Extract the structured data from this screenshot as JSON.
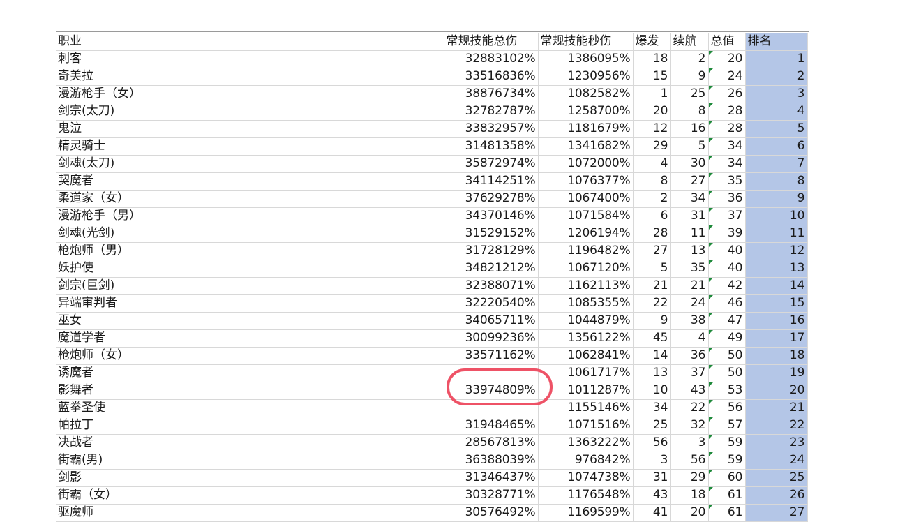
{
  "headers": {
    "job": "职业",
    "total_damage": "常规技能总伤",
    "dps": "常规技能秒伤",
    "burst": "爆发",
    "sustain": "续航",
    "total": "总值",
    "rank": "排名"
  },
  "rows": [
    {
      "job": "刺客",
      "total_damage": "32883102%",
      "dps": "1386095%",
      "burst": "18",
      "sustain": "2",
      "total": "20",
      "rank": "1"
    },
    {
      "job": "奇美拉",
      "total_damage": "33516836%",
      "dps": "1230956%",
      "burst": "15",
      "sustain": "9",
      "total": "24",
      "rank": "2"
    },
    {
      "job": "漫游枪手（女）",
      "total_damage": "38876734%",
      "dps": "1082582%",
      "burst": "1",
      "sustain": "25",
      "total": "26",
      "rank": "3"
    },
    {
      "job": "剑宗(太刀)",
      "total_damage": "32782787%",
      "dps": "1258700%",
      "burst": "20",
      "sustain": "8",
      "total": "28",
      "rank": "4"
    },
    {
      "job": "鬼泣",
      "total_damage": "33832957%",
      "dps": "1181679%",
      "burst": "12",
      "sustain": "16",
      "total": "28",
      "rank": "5"
    },
    {
      "job": "精灵骑士",
      "total_damage": "31481358%",
      "dps": "1341682%",
      "burst": "29",
      "sustain": "5",
      "total": "34",
      "rank": "6"
    },
    {
      "job": "剑魂(太刀)",
      "total_damage": "35872974%",
      "dps": "1072000%",
      "burst": "4",
      "sustain": "30",
      "total": "34",
      "rank": "7"
    },
    {
      "job": "契魔者",
      "total_damage": "34114251%",
      "dps": "1076377%",
      "burst": "8",
      "sustain": "27",
      "total": "35",
      "rank": "8"
    },
    {
      "job": "柔道家（女）",
      "total_damage": "37629278%",
      "dps": "1067400%",
      "burst": "2",
      "sustain": "34",
      "total": "36",
      "rank": "9"
    },
    {
      "job": "漫游枪手（男）",
      "total_damage": "34370146%",
      "dps": "1071584%",
      "burst": "6",
      "sustain": "31",
      "total": "37",
      "rank": "10"
    },
    {
      "job": "剑魂(光剑)",
      "total_damage": "31529152%",
      "dps": "1206194%",
      "burst": "28",
      "sustain": "11",
      "total": "39",
      "rank": "11"
    },
    {
      "job": "枪炮师（男）",
      "total_damage": "31728129%",
      "dps": "1196482%",
      "burst": "27",
      "sustain": "13",
      "total": "40",
      "rank": "12"
    },
    {
      "job": "妖护使",
      "total_damage": "34821212%",
      "dps": "1067120%",
      "burst": "5",
      "sustain": "35",
      "total": "40",
      "rank": "13"
    },
    {
      "job": "剑宗(巨剑)",
      "total_damage": "32388071%",
      "dps": "1162113%",
      "burst": "21",
      "sustain": "21",
      "total": "42",
      "rank": "14"
    },
    {
      "job": "异端审判者",
      "total_damage": "32220540%",
      "dps": "1085355%",
      "burst": "22",
      "sustain": "24",
      "total": "46",
      "rank": "15"
    },
    {
      "job": "巫女",
      "total_damage": "34065711%",
      "dps": "1044879%",
      "burst": "9",
      "sustain": "38",
      "total": "47",
      "rank": "16"
    },
    {
      "job": "魔道学者",
      "total_damage": "30099236%",
      "dps": "1356122%",
      "burst": "45",
      "sustain": "4",
      "total": "49",
      "rank": "17"
    },
    {
      "job": "枪炮师（女）",
      "total_damage": "33571162%",
      "dps": "1062841%",
      "burst": "14",
      "sustain": "36",
      "total": "50",
      "rank": "18"
    },
    {
      "job": "诱魔者",
      "total_damage": "",
      "dps": "1061717%",
      "burst": "13",
      "sustain": "37",
      "total": "50",
      "rank": "19"
    },
    {
      "job": "影舞者",
      "total_damage": "33974809%",
      "dps": "1011287%",
      "burst": "10",
      "sustain": "43",
      "total": "53",
      "rank": "20"
    },
    {
      "job": "蓝拳圣使",
      "total_damage": "",
      "dps": "1155146%",
      "burst": "34",
      "sustain": "22",
      "total": "56",
      "rank": "21"
    },
    {
      "job": "帕拉丁",
      "total_damage": "31948465%",
      "dps": "1071516%",
      "burst": "25",
      "sustain": "32",
      "total": "57",
      "rank": "22"
    },
    {
      "job": "决战者",
      "total_damage": "28567813%",
      "dps": "1363222%",
      "burst": "56",
      "sustain": "3",
      "total": "59",
      "rank": "23"
    },
    {
      "job": "街霸(男)",
      "total_damage": "36388039%",
      "dps": "976842%",
      "burst": "3",
      "sustain": "56",
      "total": "59",
      "rank": "24"
    },
    {
      "job": "剑影",
      "total_damage": "31346437%",
      "dps": "1074738%",
      "burst": "31",
      "sustain": "29",
      "total": "60",
      "rank": "25"
    },
    {
      "job": "街霸（女）",
      "total_damage": "30328771%",
      "dps": "1176548%",
      "burst": "43",
      "sustain": "18",
      "total": "61",
      "rank": "26"
    },
    {
      "job": "驱魔师",
      "total_damage": "30576492%",
      "dps": "1169599%",
      "burst": "41",
      "sustain": "20",
      "total": "61",
      "rank": "27"
    }
  ],
  "colors": {
    "rank_fill": "#b4c6e7",
    "highlight_circle": "#ee5266",
    "comment_flag": "#1f8a3b"
  }
}
